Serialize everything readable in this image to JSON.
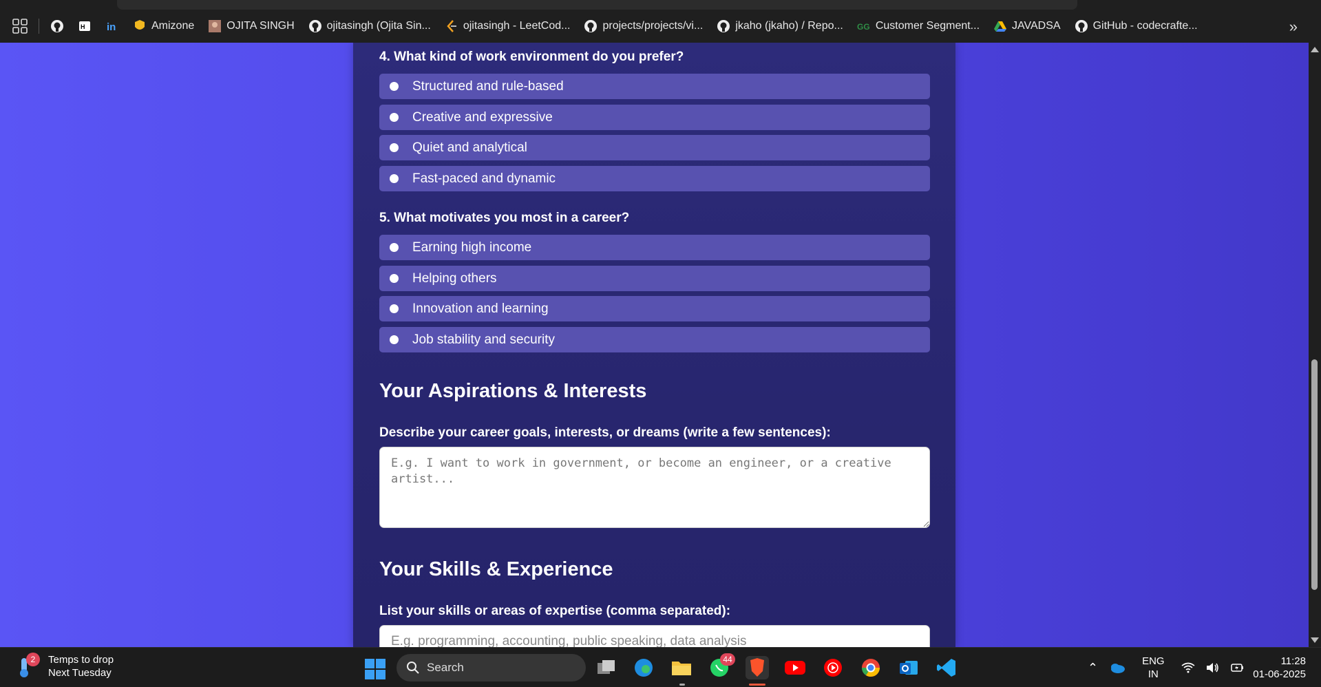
{
  "bookmarks": {
    "items": [
      {
        "label": "Amizone",
        "icon": "amizone-icon"
      },
      {
        "label": "OJITA SINGH",
        "icon": "profile-photo-icon"
      },
      {
        "label": "ojitasingh (Ojita Sin...",
        "icon": "github-icon"
      },
      {
        "label": "ojitasingh - LeetCod...",
        "icon": "leetcode-icon"
      },
      {
        "label": "projects/projects/vi...",
        "icon": "github-icon"
      },
      {
        "label": "jkaho (jkaho) / Repo...",
        "icon": "github-icon"
      },
      {
        "label": "Customer Segment...",
        "icon": "geeksforgeeks-icon"
      },
      {
        "label": "JAVADSA",
        "icon": "google-drive-icon"
      },
      {
        "label": "GitHub - codecrafte...",
        "icon": "github-icon"
      }
    ],
    "more": "»"
  },
  "form": {
    "q4": {
      "title": "4. What kind of work environment do you prefer?",
      "options": [
        "Structured and rule-based",
        "Creative and expressive",
        "Quiet and analytical",
        "Fast-paced and dynamic"
      ]
    },
    "q5": {
      "title": "5. What motivates you most in a career?",
      "options": [
        "Earning high income",
        "Helping others",
        "Innovation and learning",
        "Job stability and security"
      ]
    },
    "aspirations": {
      "heading": "Your Aspirations & Interests",
      "label": "Describe your career goals, interests, or dreams (write a few sentences):",
      "placeholder": "E.g. I want to work in government, or become an engineer, or a creative artist..."
    },
    "skills": {
      "heading": "Your Skills & Experience",
      "label": "List your skills or areas of expertise (comma separated):",
      "placeholder": "E.g. programming, accounting, public speaking, data analysis"
    }
  },
  "taskbar": {
    "weather_badge": "2",
    "weather_line1": "Temps to drop",
    "weather_line2": "Next Tuesday",
    "search_label": "Search",
    "whatsapp_badge": "44",
    "lang_line1": "ENG",
    "lang_line2": "IN",
    "time": "11:28",
    "date": "01-06-2025"
  },
  "colors": {
    "page_bg": "#4f46e5",
    "card_bg": "#2d2b7a",
    "option_bg": "#5852b0"
  }
}
